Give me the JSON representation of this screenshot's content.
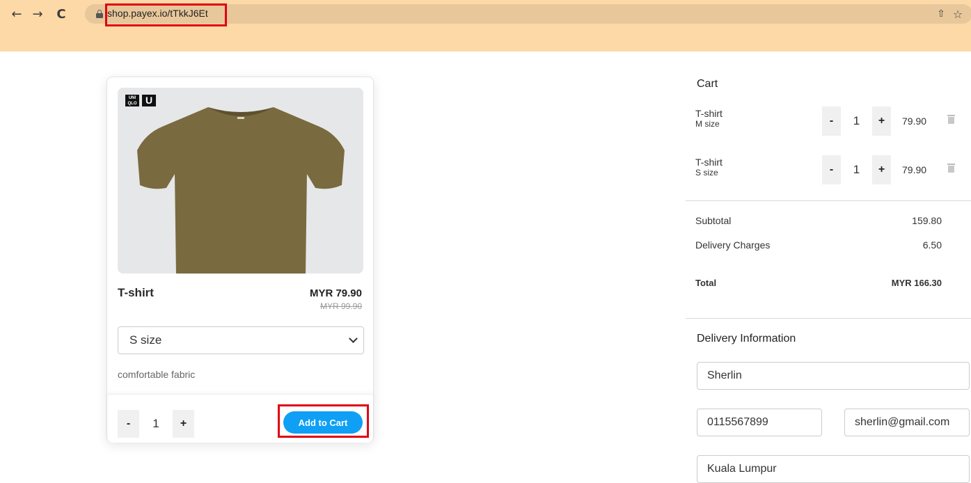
{
  "browser": {
    "url": "shop.payex.io/tTkkJ6Et",
    "back_icon": "←",
    "forward_icon": "→",
    "reload_icon": "C",
    "share_icon": "⇧",
    "star_icon": "☆"
  },
  "product": {
    "brand_logo_top": "UNI",
    "brand_logo_bottom": "QLO",
    "brand_logo_u": "U",
    "name": "T-shirt",
    "price": "MYR 79.90",
    "old_price": "MYR 99.90",
    "selected_size": "S size",
    "description": "comfortable fabric",
    "quantity": "1",
    "minus_label": "-",
    "plus_label": "+",
    "add_to_cart_label": "Add to Cart",
    "shirt_color": "#7a6a3f"
  },
  "cart": {
    "title": "Cart",
    "items": [
      {
        "name": "T-shirt",
        "size": "M size",
        "quantity": "1",
        "amount": "79.90"
      },
      {
        "name": "T-shirt",
        "size": "S size",
        "quantity": "1",
        "amount": "79.90"
      }
    ],
    "minus_label": "-",
    "plus_label": "+",
    "subtotal_label": "Subtotal",
    "subtotal_value": "159.80",
    "delivery_label": "Delivery Charges",
    "delivery_value": "6.50",
    "total_label": "Total",
    "total_value": "MYR 166.30"
  },
  "delivery": {
    "title": "Delivery Information",
    "name": "Sherlin",
    "phone": "0115567899",
    "email": "sherlin@gmail.com",
    "city": "Kuala Lumpur"
  },
  "colors": {
    "browser_bar": "#fdd9a8",
    "accent_button": "#0fa0f5",
    "highlight": "#e00012"
  }
}
